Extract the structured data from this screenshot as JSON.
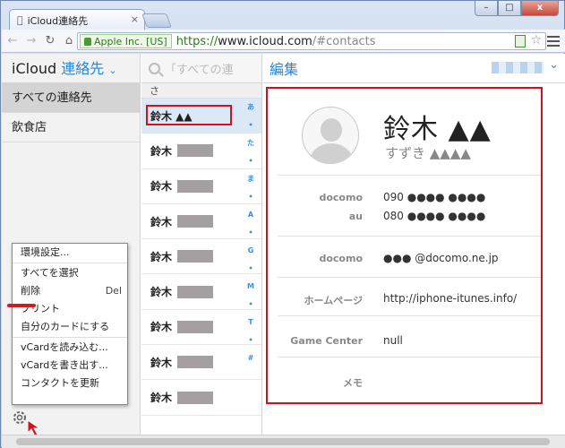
{
  "browser": {
    "tab_title": "iCloud連絡先",
    "tab_close": "×",
    "ev_label": "Apple Inc. [US]",
    "url_https": "https://",
    "url_host": "www.icloud.com",
    "url_path": "/#contacts",
    "win_min": "–",
    "win_max": "□",
    "win_close": "x"
  },
  "sidebar": {
    "app_name": "iCloud",
    "section": "連絡先",
    "items": [
      {
        "label": "すべての連絡先",
        "selected": true
      },
      {
        "label": "飲食店",
        "selected": false
      }
    ]
  },
  "menu": {
    "items": [
      {
        "label": "環境設定..."
      },
      {
        "label": "すべてを選択"
      },
      {
        "label": "削除",
        "shortcut": "Del"
      },
      {
        "label": "プリント"
      },
      {
        "label": "自分のカードにする"
      },
      {
        "label": "vCardを読み込む..."
      },
      {
        "label": "vCardを書き出す..."
      },
      {
        "label": "コンタクトを更新"
      }
    ]
  },
  "list": {
    "search_placeholder": "「すべての連",
    "section_header": "さ",
    "rows": [
      {
        "name": "鈴木 ▲▲",
        "selected": true
      },
      {
        "name": "鈴木"
      },
      {
        "name": "鈴木"
      },
      {
        "name": "鈴木"
      },
      {
        "name": "鈴木"
      },
      {
        "name": "鈴木"
      },
      {
        "name": "鈴木"
      },
      {
        "name": "鈴木"
      },
      {
        "name": "鈴木"
      }
    ],
    "index": [
      "あ",
      "•",
      "た",
      "•",
      "ま",
      "•",
      "A",
      "•",
      "G",
      "•",
      "M",
      "•",
      "T",
      "•",
      "#"
    ]
  },
  "detail": {
    "edit_label": "編集",
    "name": "鈴木 ▲▲",
    "kana": "すずき ▲▲▲▲",
    "phones": [
      {
        "label": "docomo",
        "value": "090 ●●●● ●●●●"
      },
      {
        "label": "au",
        "value": "080 ●●●● ●●●●"
      }
    ],
    "email": {
      "label": "docomo",
      "value": "●●● @docomo.ne.jp"
    },
    "homepage": {
      "label": "ホームページ",
      "value": "http://iphone-itunes.info/"
    },
    "game_center": {
      "label": "Game Center",
      "value": "null"
    },
    "memo": {
      "label": "メモ",
      "value": ""
    }
  },
  "colors": {
    "accent": "#2a87d6",
    "highlight_red": "#d2101e",
    "ev_green": "#2c7a1d"
  }
}
